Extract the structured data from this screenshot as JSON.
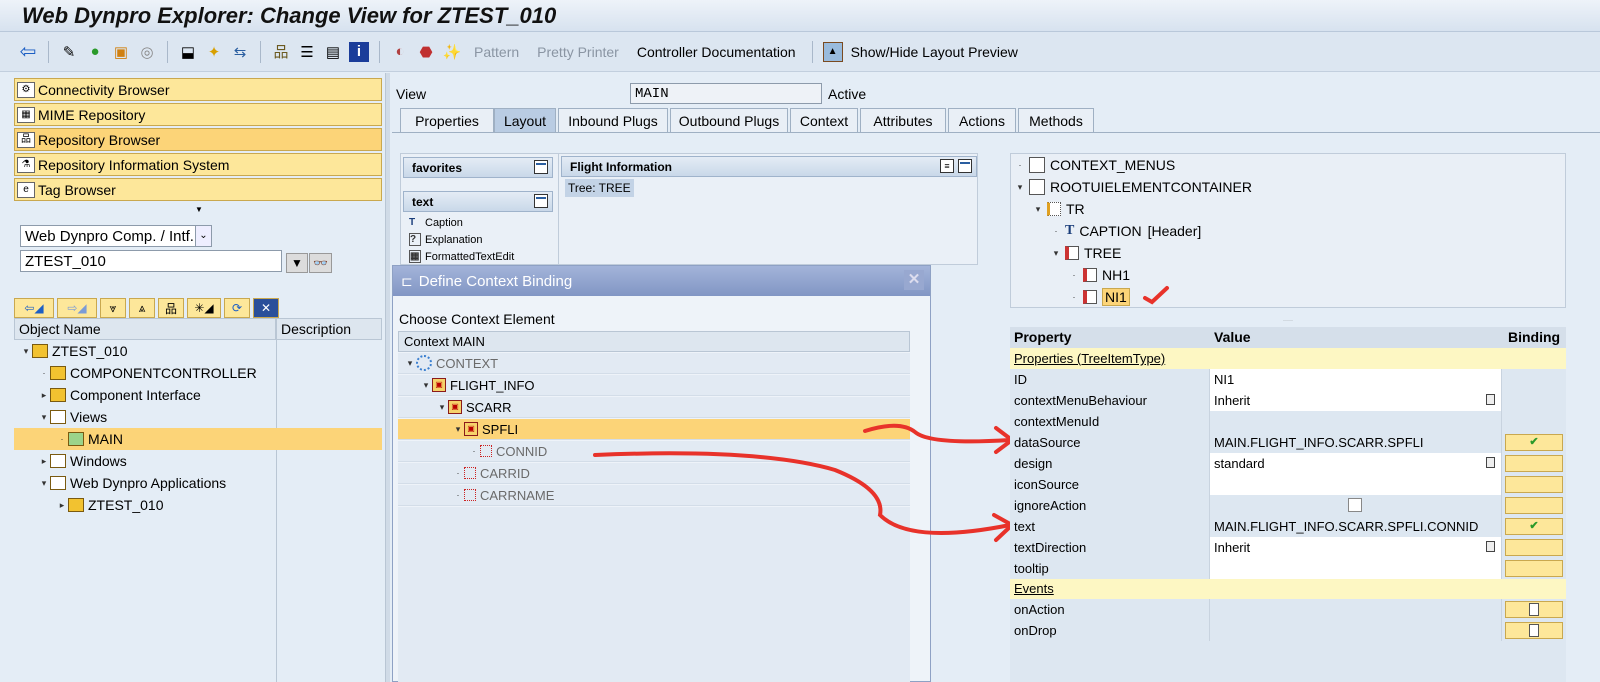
{
  "title": "Web Dynpro Explorer: Change View for ZTEST_010",
  "toolbar": {
    "pattern": "Pattern",
    "pretty_printer": "Pretty Printer",
    "controller_doc": "Controller Documentation",
    "layout_preview": "Show/Hide Layout Preview"
  },
  "nav": [
    "Connectivity Browser",
    "MIME Repository",
    "Repository Browser",
    "Repository Information System",
    "Tag Browser"
  ],
  "object_type": "Web Dynpro Comp. / Intf.",
  "object_name": "ZTEST_010",
  "obj_tree": {
    "col_name": "Object Name",
    "col_desc": "Description",
    "items": [
      "ZTEST_010",
      "COMPONENTCONTROLLER",
      "Component Interface",
      "Views",
      "MAIN",
      "Windows",
      "Web Dynpro Applications",
      "ZTEST_010"
    ]
  },
  "view": {
    "label": "View",
    "name": "MAIN",
    "status": "Active"
  },
  "tabs": [
    "Properties",
    "Layout",
    "Inbound Plugs",
    "Outbound Plugs",
    "Context",
    "Attributes",
    "Actions",
    "Methods"
  ],
  "palette": {
    "favorites": "favorites",
    "text": "text",
    "items": [
      "Caption",
      "Explanation",
      "FormattedTextEdit"
    ]
  },
  "editor": {
    "title": "Flight Information",
    "tree_label": "Tree: TREE"
  },
  "ui_tree": [
    "CONTEXT_MENUS",
    "ROOTUIELEMENTCONTAINER",
    "TR",
    "CAPTION",
    "[Header]",
    "TREE",
    "NH1",
    "NI1"
  ],
  "props": {
    "h_property": "Property",
    "h_value": "Value",
    "h_binding": "Binding",
    "section": "Properties (TreeItemType)",
    "events": "Events",
    "rows": [
      [
        "ID",
        "NI1"
      ],
      [
        "contextMenuBehaviour",
        "Inherit"
      ],
      [
        "contextMenuId",
        ""
      ],
      [
        "dataSource",
        "MAIN.FLIGHT_INFO.SCARR.SPFLI"
      ],
      [
        "design",
        "standard"
      ],
      [
        "iconSource",
        ""
      ],
      [
        "ignoreAction",
        ""
      ],
      [
        "text",
        "MAIN.FLIGHT_INFO.SCARR.SPFLI.CONNID"
      ],
      [
        "textDirection",
        "Inherit"
      ],
      [
        "tooltip",
        ""
      ]
    ],
    "event_rows": [
      "onAction",
      "onDrop"
    ]
  },
  "dialog": {
    "title": "Define Context Binding",
    "choose": "Choose Context Element",
    "header": "Context MAIN",
    "nodes": [
      "CONTEXT",
      "FLIGHT_INFO",
      "SCARR",
      "SPFLI",
      "CONNID",
      "CARRID",
      "CARRNAME"
    ]
  },
  "colors": {
    "highlight": "#fcd478",
    "annotation": "#e8322a"
  }
}
